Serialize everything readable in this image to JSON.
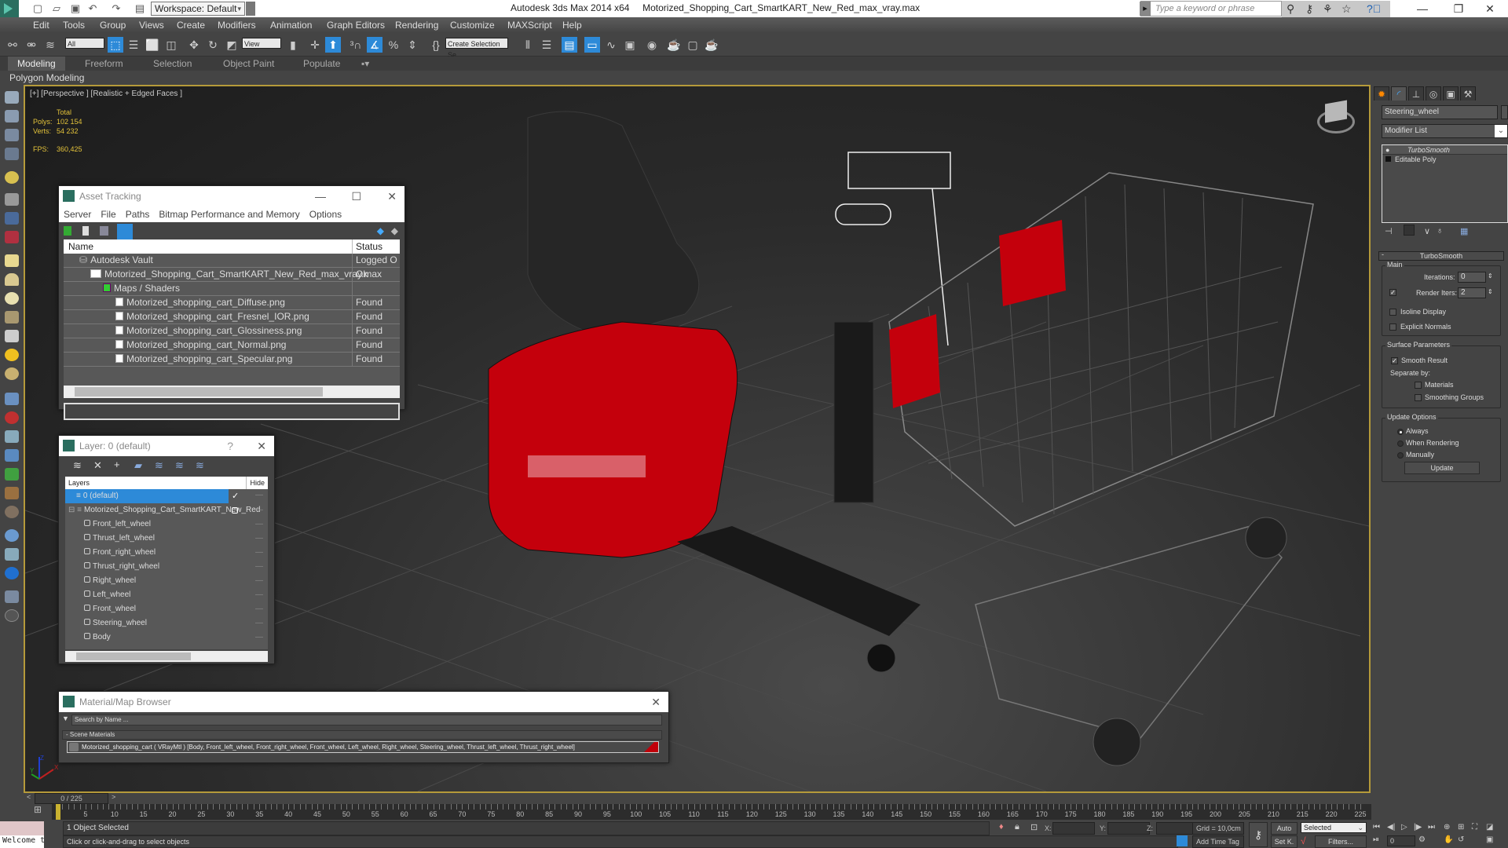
{
  "app": {
    "title": "Autodesk 3ds Max  2014 x64",
    "file": "Motorized_Shopping_Cart_SmartKART_New_Red_max_vray.max",
    "workspace": "Workspace: Default",
    "search_placeholder": "Type a keyword or phrase"
  },
  "menu": [
    "Edit",
    "Tools",
    "Group",
    "Views",
    "Create",
    "Modifiers",
    "Animation",
    "Graph Editors",
    "Rendering",
    "Customize",
    "MAXScript",
    "Help"
  ],
  "toolbar": {
    "selection_filter": "All",
    "reference_coord": "View",
    "named_selection": "Create Selection Se"
  },
  "ribbon": {
    "tabs": [
      "Modeling",
      "Freeform",
      "Selection",
      "Object Paint",
      "Populate"
    ],
    "active_tab": "Modeling",
    "panel_label": "Polygon Modeling"
  },
  "viewport": {
    "label": "[+] [Perspective ] [Realistic + Edged Faces ]",
    "stats": {
      "header": "Total",
      "polys_label": "Polys:",
      "polys": "102 154",
      "verts_label": "Verts:",
      "verts": "54 232",
      "fps_label": "FPS:",
      "fps": "360,425"
    },
    "axis": {
      "x": "X",
      "y": "Y",
      "z": "Z"
    }
  },
  "asset_tracking": {
    "title": "Asset Tracking",
    "menu": [
      "Server",
      "File",
      "Paths",
      "Bitmap Performance and Memory",
      "Options"
    ],
    "columns": [
      "Name",
      "Status"
    ],
    "rows": [
      {
        "name": "Autodesk Vault",
        "status": "Logged O..."
      },
      {
        "name": "Motorized_Shopping_Cart_SmartKART_New_Red_max_vray.max",
        "status": "Ok"
      },
      {
        "name": "Maps / Shaders",
        "status": ""
      },
      {
        "name": "Motorized_shopping_cart_Diffuse.png",
        "status": "Found"
      },
      {
        "name": "Motorized_shopping_cart_Fresnel_IOR.png",
        "status": "Found"
      },
      {
        "name": "Motorized_shopping_cart_Glossiness.png",
        "status": "Found"
      },
      {
        "name": "Motorized_shopping_cart_Normal.png",
        "status": "Found"
      },
      {
        "name": "Motorized_shopping_cart_Specular.png",
        "status": "Found"
      }
    ]
  },
  "layer_window": {
    "title": "Layer: 0 (default)",
    "help": "?",
    "columns": [
      "Layers",
      "Hide"
    ],
    "layers": [
      {
        "name": "0 (default)",
        "selected": true
      },
      {
        "name": "Motorized_Shopping_Cart_SmartKART_New_Red"
      }
    ],
    "objects": [
      "Front_left_wheel",
      "Thrust_left_wheel",
      "Front_right_wheel",
      "Thrust_right_wheel",
      "Right_wheel",
      "Left_wheel",
      "Front_wheel",
      "Steering_wheel",
      "Body"
    ]
  },
  "material_browser": {
    "title": "Material/Map Browser",
    "search_placeholder": "Search by Name ...",
    "section": "- Scene Materials",
    "material": "Motorized_shopping_cart  ( VRayMtl ) [Body, Front_left_wheel, Front_right_wheel, Front_wheel, Left_wheel, Right_wheel, Steering_wheel, Thrust_left_wheel, Thrust_right_wheel]",
    "swatch_color": "#c0000a"
  },
  "command_panel": {
    "object_name": "Steering_wheel",
    "modifier_list": "Modifier List",
    "stack": [
      "TurboSmooth",
      "Editable Poly"
    ],
    "rollout": "TurboSmooth",
    "main": {
      "group": "Main",
      "iterations_label": "Iterations:",
      "iterations": "0",
      "render_iters_label": "Render Iters:",
      "render_iters": "2",
      "render_iters_checked": true,
      "isoline_display": "Isoline Display",
      "explicit_normals": "Explicit Normals"
    },
    "surface": {
      "group": "Surface Parameters",
      "smooth_result": "Smooth Result",
      "separate_by": "Separate by:",
      "materials": "Materials",
      "smoothing_groups": "Smoothing Groups"
    },
    "update": {
      "group": "Update Options",
      "always": "Always",
      "when_rendering": "When Rendering",
      "manually": "Manually",
      "selected": "Always",
      "button": "Update"
    }
  },
  "timeline": {
    "frame_display": "0 / 225",
    "current_frame": 0,
    "total_frames": 225,
    "ticks": [
      0,
      5,
      10,
      15,
      20,
      25,
      30,
      35,
      40,
      45,
      50,
      55,
      60,
      65,
      70,
      75,
      80,
      85,
      90,
      95,
      100,
      105,
      110,
      115,
      120,
      125,
      130,
      135,
      140,
      145,
      150,
      155,
      160,
      165,
      170,
      175,
      180,
      185,
      190,
      195,
      200,
      205,
      210,
      215,
      220,
      225
    ]
  },
  "status": {
    "selection": "1 Object Selected",
    "prompt": "Click or click-and-drag to select objects",
    "welcome": "Welcome to",
    "x_label": "X:",
    "y_label": "Y:",
    "z_label": "Z:",
    "grid": "Grid = 10,0cm",
    "add_time_tag": "Add Time Tag",
    "auto": "Auto",
    "set_key": "Set K.",
    "key_filter": "Selected",
    "filters": "Filters...",
    "frame_field": "0"
  },
  "colors": {
    "accent": "#2d8ad8",
    "viewport_border": "#b59a3a",
    "stats_text": "#e3c23a",
    "cart_red": "#d0000c"
  }
}
